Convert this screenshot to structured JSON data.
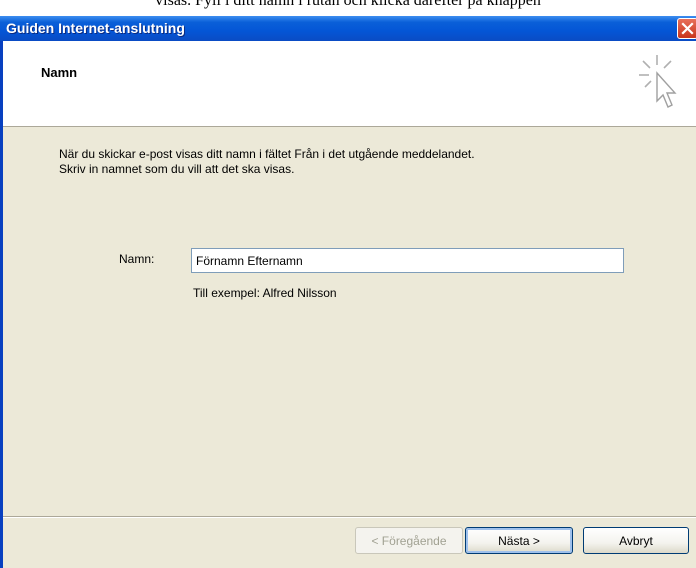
{
  "caption": "visas. Fyll i ditt namn i rutan och klicka därefter på knappen",
  "window": {
    "title": "Guiden Internet-anslutning"
  },
  "header": {
    "title": "Namn"
  },
  "body": {
    "description_line1": "När du skickar e-post visas ditt namn i fältet Från i det utgående meddelandet.",
    "description_line2": "Skriv in namnet som du vill att det ska visas.",
    "name_label": "Namn:",
    "name_value": "Förnamn Efternamn",
    "example": "Till exempel: Alfred Nilsson"
  },
  "buttons": {
    "back": "< Föregående",
    "next": "Nästa >",
    "cancel": "Avbryt"
  },
  "icons": {
    "close": "close-icon",
    "wizard": "wizard-cursor-icon"
  }
}
